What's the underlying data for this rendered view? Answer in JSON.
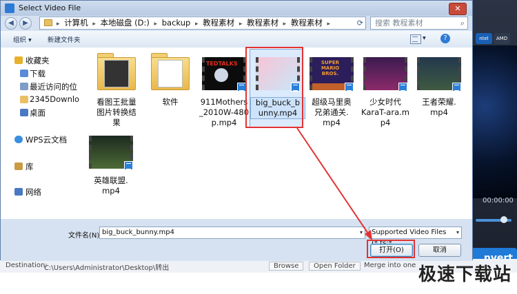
{
  "dialog": {
    "title": "Select Video File",
    "close_glyph": "✕",
    "address": {
      "crumbs": [
        "计算机",
        "本地磁盘 (D:)",
        "backup",
        "教程素材",
        "教程素材",
        "教程素材"
      ],
      "separator": "▸",
      "search_placeholder": "搜索 教程素材"
    },
    "toolbar": {
      "organize": "组织 ▾",
      "new_folder": "新建文件夹"
    },
    "sidebar": [
      {
        "label": "收藏夹",
        "icon": "star-icon",
        "color": "#e8b12c"
      },
      {
        "label": "下载",
        "icon": "download-folder-icon",
        "color": "#5b8ad6"
      },
      {
        "label": "最近访问的位",
        "icon": "recent-icon",
        "color": "#7d9cc6"
      },
      {
        "label": "2345Downlo",
        "icon": "folder-icon",
        "color": "#e9c063"
      },
      {
        "label": "桌面",
        "icon": "desktop-icon",
        "color": "#4a78c2"
      },
      {
        "label": "WPS云文档",
        "icon": "cloud-icon",
        "color": "#3b8fe0"
      },
      {
        "label": "库",
        "icon": "library-icon",
        "color": "#c99c44"
      },
      {
        "label": "网络",
        "icon": "network-icon",
        "color": "#4a78c2"
      }
    ],
    "files": [
      {
        "label": "看图王批量\n图片转换结\n果",
        "kind": "folder"
      },
      {
        "label": "软件",
        "kind": "folder"
      },
      {
        "label": "911Mothers\n_2010W-480\np.mp4",
        "kind": "video",
        "thumb": "TEDTALKS"
      },
      {
        "label": "big_buck_b\nunny.mp4",
        "kind": "video",
        "selected": true
      },
      {
        "label": "超级马里奥\n兄弟通关.\nmp4",
        "kind": "video",
        "thumb": "SUPER MARIO BROS."
      },
      {
        "label": "少女时代\nKaraT-ara.m\np4",
        "kind": "video"
      },
      {
        "label": "王者荣耀.\nmp4",
        "kind": "video"
      },
      {
        "label": "英雄联盟.\nmp4",
        "kind": "video"
      }
    ],
    "filename_label": "文件名(N):",
    "filename_value": "big_buck_bunny.mp4",
    "filetype": "Supported Video Files (*.ts;*",
    "open_button": "打开(O)",
    "cancel_button": "取消"
  },
  "background": {
    "time": "00:00:00",
    "convert_label": "nvert",
    "chip1": "ntel",
    "chip2": "AMD",
    "destination_label": "Destination:",
    "destination_value": "C:\\Users\\Administrator\\Desktop\\转出",
    "browse": "Browse",
    "open_folder": "Open Folder",
    "merge": "Merge into one",
    "watermark": "极速下载站"
  },
  "colors": {
    "accent": "#2d7bd6",
    "highlight": "#e33232"
  }
}
